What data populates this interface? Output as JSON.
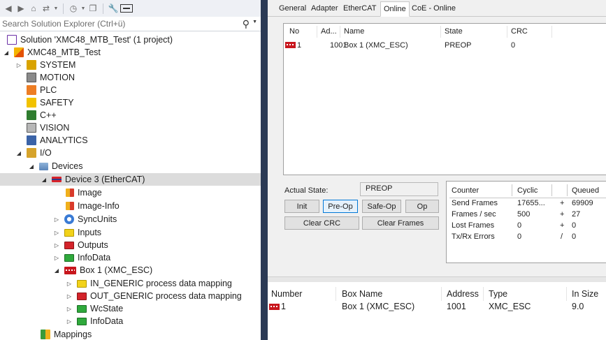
{
  "toolbar": {
    "items": [
      "back-icon",
      "forward-icon",
      "home-icon",
      "sync-view-icon",
      "history-icon",
      "show-all-icon",
      "properties-icon",
      "preview-icon"
    ]
  },
  "search": {
    "placeholder": "Search Solution Explorer (Ctrl+ü)"
  },
  "tree": {
    "solution": "Solution 'XMC48_MTB_Test' (1 project)",
    "project": "XMC48_MTB_Test",
    "system": "SYSTEM",
    "motion": "MOTION",
    "plc": "PLC",
    "safety": "SAFETY",
    "cpp": "C++",
    "vision": "VISION",
    "analytics": "ANALYTICS",
    "io": "I/O",
    "devices": "Devices",
    "device3": "Device 3 (EtherCAT)",
    "image": "Image",
    "image_info": "Image-Info",
    "syncunits": "SyncUnits",
    "inputs": "Inputs",
    "outputs": "Outputs",
    "infodata": "InfoData",
    "box1": "Box 1 (XMC_ESC)",
    "in_generic": "IN_GENERIC process data mapping",
    "out_generic": "OUT_GENERIC process data mapping",
    "wcstate": "WcState",
    "box_infodata": "InfoData",
    "mappings": "Mappings"
  },
  "tabs": [
    "General",
    "Adapter",
    "EtherCAT",
    "Online",
    "CoE - Online"
  ],
  "active_tab": "Online",
  "online_list": {
    "columns": [
      "No",
      "Ad...",
      "Name",
      "State",
      "CRC"
    ],
    "row": {
      "no": "1",
      "addr": "1001",
      "name": "Box 1 (XMC_ESC)",
      "state": "PREOP",
      "crc": "0"
    }
  },
  "actual_state": {
    "label": "Actual State:",
    "value": "PREOP"
  },
  "buttons": {
    "init": "Init",
    "preop": "Pre-Op",
    "safeop": "Safe-Op",
    "op": "Op",
    "clear_crc": "Clear CRC",
    "clear_frames": "Clear Frames"
  },
  "stats": {
    "headers": {
      "counter": "Counter",
      "cyclic": "Cyclic",
      "queued": "Queued"
    },
    "rows": [
      {
        "label": "Send Frames",
        "cyclic": "17655...",
        "op": "+",
        "queued": "69909"
      },
      {
        "label": "Frames / sec",
        "cyclic": "500",
        "op": "+",
        "queued": "27"
      },
      {
        "label": "Lost Frames",
        "cyclic": "0",
        "op": "+",
        "queued": "0"
      },
      {
        "label": "Tx/Rx Errors",
        "cyclic": "0",
        "op": "/",
        "queued": "0"
      }
    ]
  },
  "bottom_table": {
    "columns": [
      "Number",
      "Box Name",
      "Address",
      "Type",
      "In Size"
    ],
    "row": {
      "number": "1",
      "box_name": "Box 1 (XMC_ESC)",
      "address": "1001",
      "type": "XMC_ESC",
      "in_size": "9.0"
    }
  },
  "colors": {
    "selection": "#cce8ff",
    "splitter": "#2b3a55",
    "ethercat_box": "#c8161d"
  }
}
